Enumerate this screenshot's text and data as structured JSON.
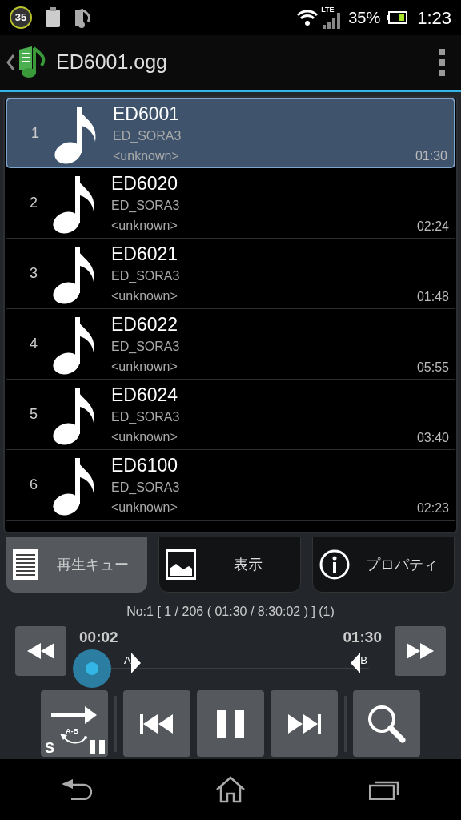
{
  "status_bar": {
    "notification_count": "35",
    "battery_text": "35%",
    "network": "LTE",
    "time": "1:23"
  },
  "title_bar": {
    "title": "ED6001.ogg"
  },
  "tracks": [
    {
      "number": "1",
      "title": "ED6001",
      "album": "ED_SORA3",
      "artist": "<unknown>",
      "duration": "01:30",
      "selected": true
    },
    {
      "number": "2",
      "title": "ED6020",
      "album": "ED_SORA3",
      "artist": "<unknown>",
      "duration": "02:24",
      "selected": false
    },
    {
      "number": "3",
      "title": "ED6021",
      "album": "ED_SORA3",
      "artist": "<unknown>",
      "duration": "01:48",
      "selected": false
    },
    {
      "number": "4",
      "title": "ED6022",
      "album": "ED_SORA3",
      "artist": "<unknown>",
      "duration": "05:55",
      "selected": false
    },
    {
      "number": "5",
      "title": "ED6024",
      "album": "ED_SORA3",
      "artist": "<unknown>",
      "duration": "03:40",
      "selected": false
    },
    {
      "number": "6",
      "title": "ED6100",
      "album": "ED_SORA3",
      "artist": "<unknown>",
      "duration": "02:23",
      "selected": false
    }
  ],
  "tabs": [
    {
      "kind": "queue",
      "label": "再生キュー",
      "selected": true
    },
    {
      "kind": "display",
      "label": "表示",
      "selected": false
    },
    {
      "kind": "properties",
      "label": "プロパティ",
      "selected": false
    }
  ],
  "info_line": "No:1 [ 1 / 206 ( 01:30 / 8:30:02 ) ] (1)",
  "seek": {
    "elapsed": "00:02",
    "total": "01:30",
    "marker_a": "A",
    "marker_b": "B"
  },
  "repeat_button": {
    "label_s": "S",
    "label_ab": "A-B"
  }
}
